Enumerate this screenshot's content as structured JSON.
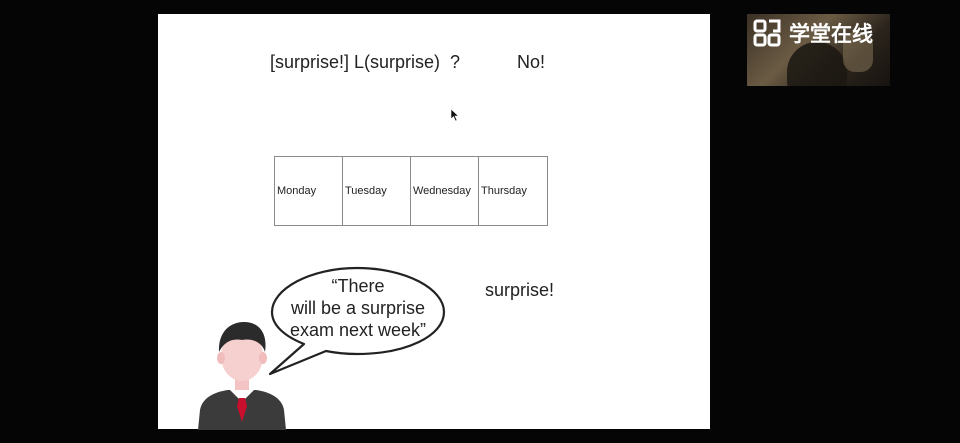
{
  "slide": {
    "formula": "[surprise!] L(surprise)  ?",
    "answer": "No!",
    "days": [
      "Monday",
      "Tuesday",
      "Wednesday",
      "Thursday"
    ],
    "speech": [
      "“There",
      "will be a surprise",
      "exam next week”"
    ],
    "surprise_label": "surprise!"
  },
  "watermark": {
    "text": "学堂在线",
    "icon": "xuetangx-logo-icon"
  },
  "colors": {
    "background": "#050505",
    "slide": "#ffffff",
    "tie": "#c8102e",
    "suit": "#3b3b3b"
  }
}
